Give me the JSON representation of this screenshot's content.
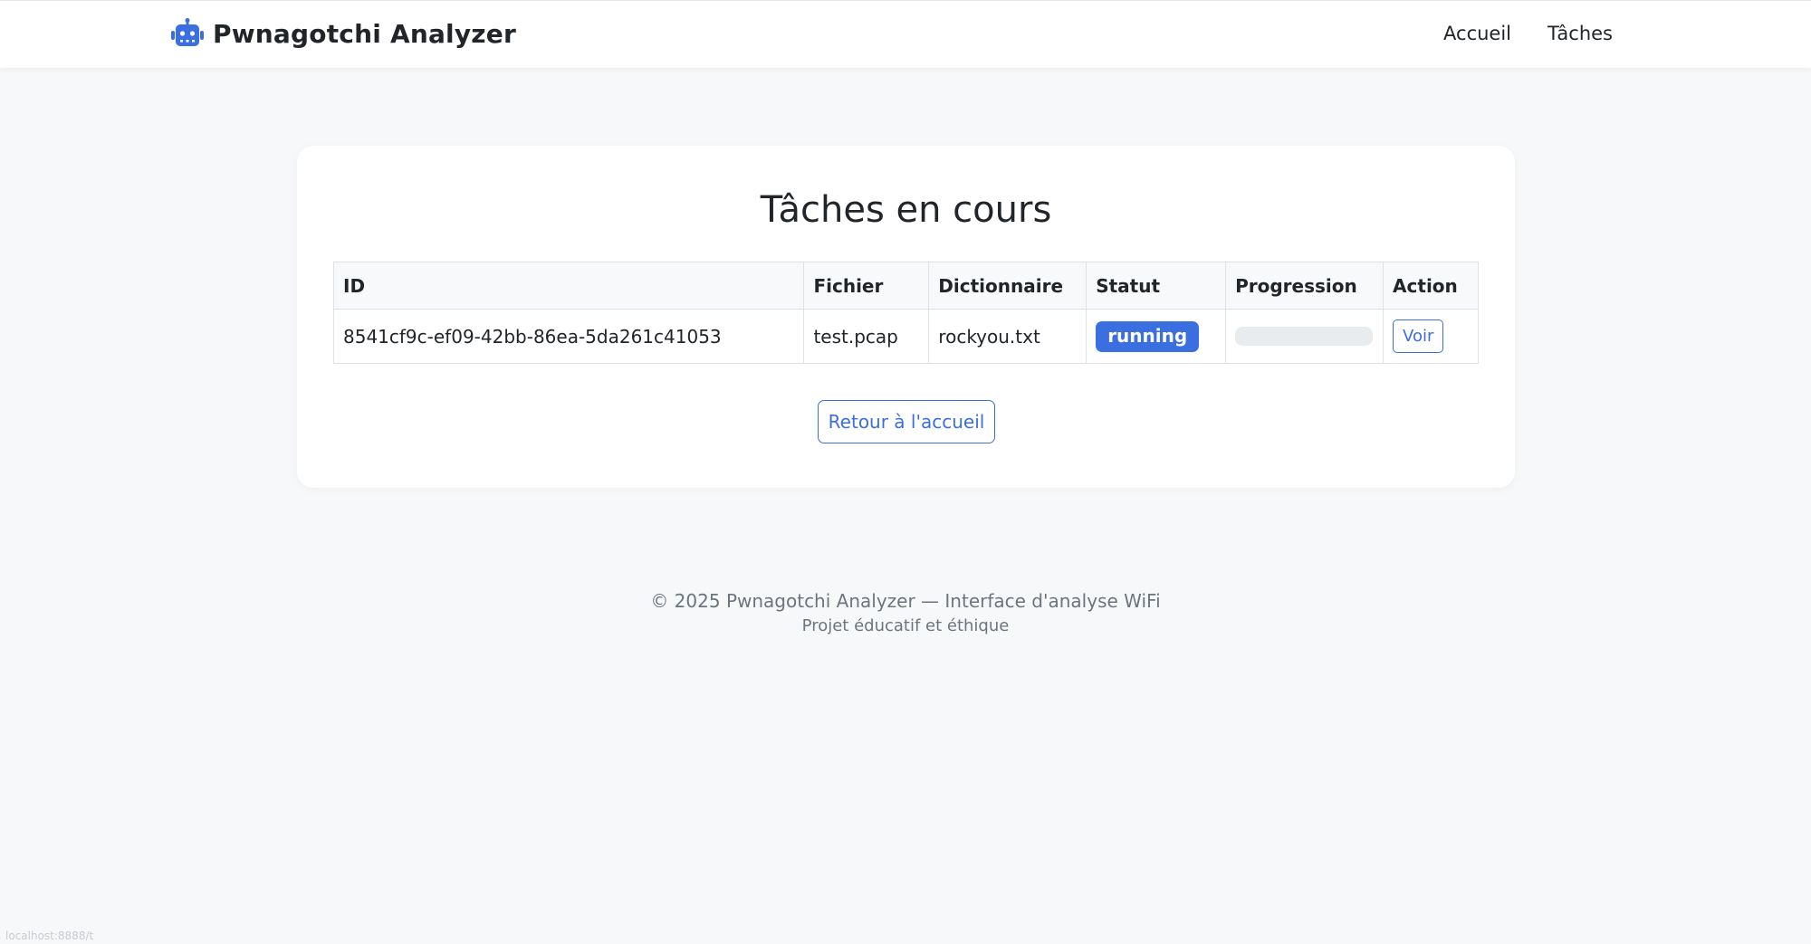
{
  "navbar": {
    "brand": "Pwnagotchi Analyzer",
    "brand_icon": "robot-icon",
    "links": [
      {
        "label": "Accueil"
      },
      {
        "label": "Tâches"
      }
    ]
  },
  "main": {
    "title": "Tâches en cours",
    "table": {
      "headers": [
        "ID",
        "Fichier",
        "Dictionnaire",
        "Statut",
        "Progression",
        "Action"
      ],
      "rows": [
        {
          "id": "8541cf9c-ef09-42bb-86ea-5da261c41053",
          "file": "test.pcap",
          "dictionary": "rockyou.txt",
          "status": "running",
          "progress_percent": 0,
          "action": "Voir"
        }
      ]
    },
    "home_button": "Retour à l'accueil"
  },
  "footer": {
    "line1": "© 2025 Pwnagotchi Analyzer — Interface d'analyse WiFi",
    "line2": "Projet éducatif et éthique"
  },
  "statusbar": {
    "url": "localhost:8888/t"
  },
  "colors": {
    "accent": "#3b6fe0",
    "background": "#f7f8fa",
    "progress_track": "#e9ecef"
  }
}
